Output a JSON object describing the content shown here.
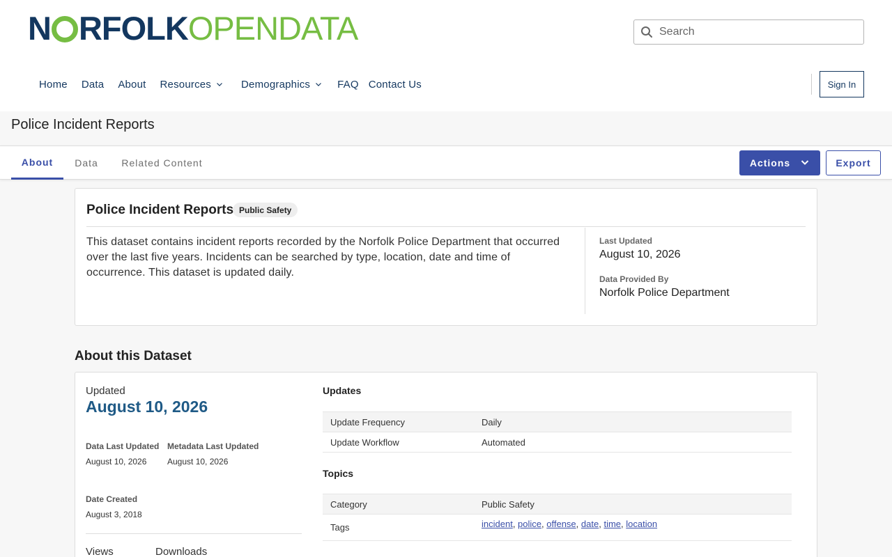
{
  "header": {
    "logo_norfolk_a": "N",
    "logo_norfolk_b": "RFOLK",
    "logo_open": "OPENDATA",
    "search_placeholder": "Search",
    "nav": [
      "Home",
      "Data",
      "About",
      "Resources",
      "Demographics",
      "FAQ",
      "Contact Us"
    ],
    "sign_in": "Sign In",
    "brand_navy": "#13375f",
    "brand_green": "#76bd43"
  },
  "page_title": "Police Incident Reports",
  "tabs": {
    "about": "About",
    "data": "Data",
    "related": "Related Content",
    "actions": "Actions",
    "export": "Export",
    "accent": "#3a4fa8"
  },
  "summary": {
    "title": "Police Incident Reports",
    "category": "Public Safety",
    "description": "This dataset contains incident reports recorded by the Norfolk Police Department that occurred over the last five years. Incidents can be searched by type, location, date and time of occurrence. This dataset is updated daily.",
    "last_updated_label": "Last Updated",
    "last_updated_value": "August 10, 2026",
    "provided_by_label": "Data Provided By",
    "provided_by_value": "Norfolk Police Department"
  },
  "about": {
    "heading": "About this Dataset",
    "updated_label": "Updated",
    "updated_date": "August 10, 2026",
    "data_last_updated_label": "Data Last Updated",
    "data_last_updated_value": "August 10, 2026",
    "metadata_last_updated_label": "Metadata Last Updated",
    "metadata_last_updated_value": "August 10, 2026",
    "date_created_label": "Date Created",
    "date_created_value": "August 3, 2018",
    "views_label": "Views",
    "downloads_label": "Downloads",
    "updates_title": "Updates",
    "update_frequency_label": "Update Frequency",
    "update_frequency_value": "Daily",
    "update_workflow_label": "Update Workflow",
    "update_workflow_value": "Automated",
    "topics_title": "Topics",
    "category_label": "Category",
    "category_value": "Public Safety",
    "tags_label": "Tags",
    "tags": [
      "incident",
      "police",
      "offense",
      "date",
      "time",
      "location"
    ]
  }
}
